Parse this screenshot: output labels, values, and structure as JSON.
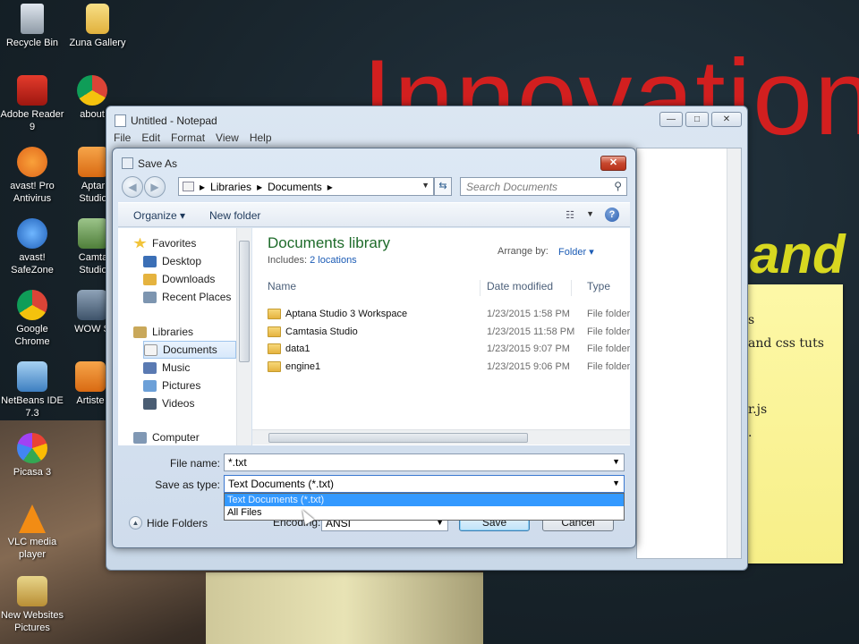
{
  "wallpaper": {
    "headline": "Innovation",
    "sub": "and"
  },
  "sticky_note": {
    "lines": [
      "s",
      "and css tuts",
      "r.js",
      "."
    ]
  },
  "desktop_icons": [
    {
      "label": "Recycle Bin"
    },
    {
      "label": "Zuna Gallery"
    },
    {
      "label": "Adobe Reader 9"
    },
    {
      "label": "about"
    },
    {
      "label": "avast! Pro Antivirus"
    },
    {
      "label": "Aptar Studio"
    },
    {
      "label": "avast! SafeZone"
    },
    {
      "label": "Camta Studio"
    },
    {
      "label": "Google Chrome"
    },
    {
      "label": "WOW S"
    },
    {
      "label": "NetBeans IDE 7.3"
    },
    {
      "label": "Artiste"
    },
    {
      "label": "Picasa 3"
    },
    {
      "label": "VLC media player"
    },
    {
      "label": "New Websites Pictures"
    }
  ],
  "notepad": {
    "title": "Untitled - Notepad",
    "menu": [
      "File",
      "Edit",
      "Format",
      "View",
      "Help"
    ],
    "controls": {
      "minimize": "—",
      "maximize": "□",
      "close": "✕"
    }
  },
  "dialog": {
    "title": "Save As",
    "close": "✕",
    "breadcrumb": [
      "Libraries",
      "Documents"
    ],
    "search_placeholder": "Search Documents",
    "toolbar": {
      "organize": "Organize ▾",
      "new_folder": "New folder"
    },
    "nav": {
      "favorites": "Favorites",
      "desktop": "Desktop",
      "downloads": "Downloads",
      "recent": "Recent Places",
      "libraries": "Libraries",
      "documents": "Documents",
      "music": "Music",
      "pictures": "Pictures",
      "videos": "Videos",
      "computer": "Computer"
    },
    "library": {
      "title": "Documents library",
      "includes_label": "Includes:",
      "includes_link": "2 locations",
      "arrange_label": "Arrange by:",
      "arrange_value": "Folder ▾"
    },
    "columns": {
      "name": "Name",
      "date": "Date modified",
      "type": "Type"
    },
    "files": [
      {
        "name": "Aptana Studio 3 Workspace",
        "date": "1/23/2015 1:58 PM",
        "type": "File folder"
      },
      {
        "name": "Camtasia Studio",
        "date": "1/23/2015 11:58 PM",
        "type": "File folder"
      },
      {
        "name": "data1",
        "date": "1/23/2015 9:07 PM",
        "type": "File folder"
      },
      {
        "name": "engine1",
        "date": "1/23/2015 9:06 PM",
        "type": "File folder"
      }
    ],
    "file_name_label": "File name:",
    "file_name_value": "*.txt",
    "save_type_label": "Save as type:",
    "save_type_value": "Text Documents (*.txt)",
    "save_type_options": [
      "Text Documents (*.txt)",
      "All Files"
    ],
    "encoding_label": "Encoding:",
    "encoding_value": "ANSI",
    "hide_folders": "Hide Folders",
    "save": "Save",
    "cancel": "Cancel"
  }
}
